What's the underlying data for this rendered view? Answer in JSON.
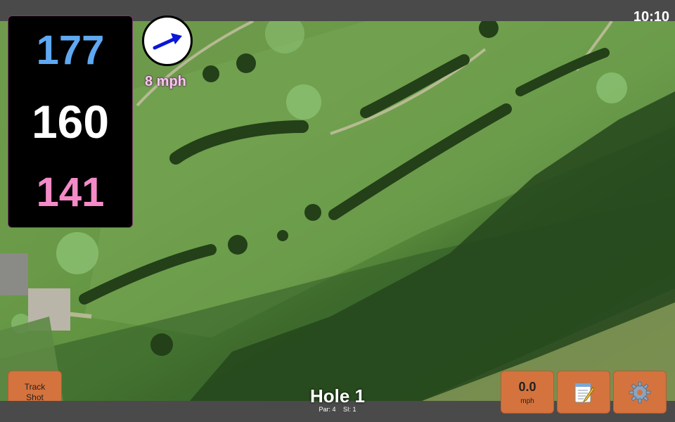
{
  "status": {
    "time": "10:10"
  },
  "distances": {
    "back": "177",
    "center": "160",
    "front": "141"
  },
  "wind": {
    "speed": "8 mph",
    "icon": "wind-arrow-icon"
  },
  "hole": {
    "title": "Hole 1",
    "par": "Par: 4",
    "si": "SI: 1"
  },
  "buttons": {
    "track_shot": [
      "Track",
      "Shot"
    ],
    "speed_value": "0.0",
    "speed_unit": "mph",
    "notes_icon": "notepad-icon",
    "settings_icon": "gear-icon"
  },
  "colors": {
    "back_distance": "#5fa8f2",
    "center_distance": "#ffffff",
    "front_distance": "#f58ac8",
    "button": "#d4733e",
    "bar": "#4a4a4a"
  }
}
